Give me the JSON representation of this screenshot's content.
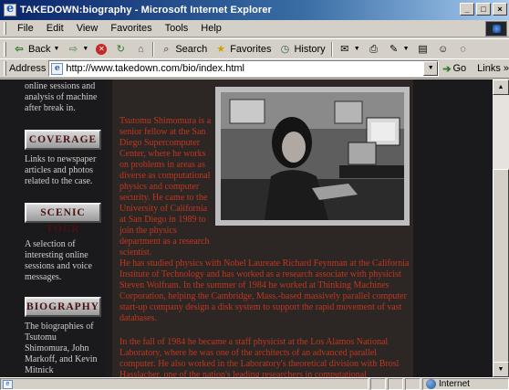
{
  "window": {
    "title": "TAKEDOWN:biography - Microsoft Internet Explorer",
    "min_label": "_",
    "max_label": "□",
    "close_label": "×"
  },
  "menu": [
    {
      "label": "File"
    },
    {
      "label": "Edit"
    },
    {
      "label": "View"
    },
    {
      "label": "Favorites"
    },
    {
      "label": "Tools"
    },
    {
      "label": "Help"
    }
  ],
  "toolbar": {
    "back_label": "Back",
    "search_label": "Search",
    "favorites_label": "Favorites",
    "history_label": "History"
  },
  "address": {
    "label": "Address",
    "url": "http://www.takedown.com/bio/index.html",
    "go_label": "Go",
    "links_label": "Links »"
  },
  "sidebar": {
    "top_text": "online sessions and analysis of machine after break in.",
    "coverage_button": "COVERAGE",
    "coverage_text": "Links to newspaper articles and photos related to the case.",
    "scenic_button": "SCENIC TOUR",
    "scenic_text": "A selection of interesting online sessions and voice messages.",
    "biography_button": "BIOGRAPHY",
    "biography_text": "The biographies of Tsutomu Shimomura, John Markoff, and Kevin Mitnick"
  },
  "main": {
    "para1": "Tsutomu Shimomura is a senior fellow at the San Diego Supercomputer Center, where he works on problems in areas as diverse as computational physics and computer security. He came to the University of California at San Diego in 1989 to join the physics department as a research scientist.",
    "para2": "He has studied physics with Nobel Laureate Richard Feynman at the California Institute of Technology and has worked as a research associate with physicist Steven Wolfram. In the summer of 1984 he worked at Thinking Machines Corporation, helping the Cambridge, Mass.-based massively parallel computer start-up company design a disk system to support the rapid movement of vast databases.",
    "para3": "In the fall of 1984 he became a staff physicist at the Los Alamos National Laboratory, where he was one of the architects of an advanced parallel computer. He also worked in the Laboratory's theoretical division with Brosl Hasslacher, one of the nation's leading researchers in computational"
  },
  "status": {
    "zone_label": "Internet"
  },
  "colors": {
    "body_text": "#c2361f",
    "page_bg": "#1c1c1e",
    "title_bar": "#0a246a"
  }
}
